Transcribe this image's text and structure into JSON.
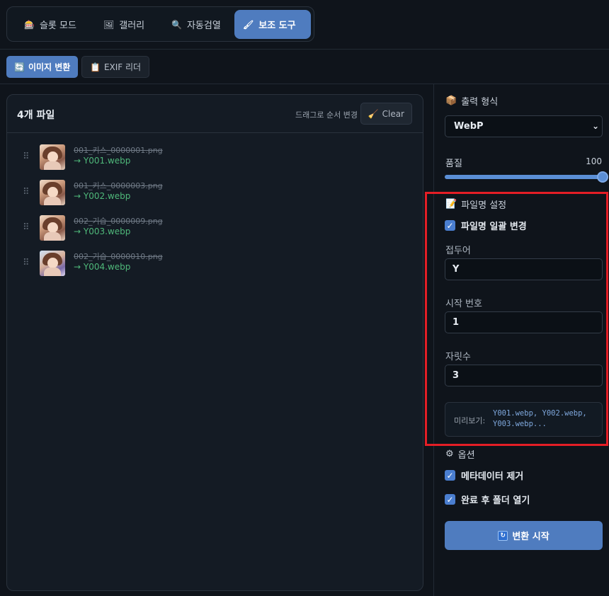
{
  "tabs": [
    {
      "icon": "slot-icon",
      "glyph": "🎰",
      "label": "슬롯 모드",
      "active": false
    },
    {
      "icon": "gallery-icon",
      "glyph": "🖼",
      "label": "갤러리",
      "active": false
    },
    {
      "icon": "search-icon",
      "glyph": "🔍",
      "label": "자동검열",
      "active": false
    },
    {
      "icon": "brush-icon",
      "glyph": "🖌",
      "label": "보조 도구",
      "active": true
    }
  ],
  "subtabs": [
    {
      "icon": "convert-icon",
      "glyph": "🔄",
      "label": "이미지 변환",
      "active": true
    },
    {
      "icon": "clipboard-icon",
      "glyph": "📋",
      "label": "EXIF 리더",
      "active": false
    }
  ],
  "file_panel": {
    "title": "4개 파일",
    "hint": "드래그로 순서 변경",
    "clear_label": "Clear",
    "files": [
      {
        "original": "001_키스_0000001.png",
        "renamed": "→ Y001.webp"
      },
      {
        "original": "001_키스_0000003.png",
        "renamed": "→ Y002.webp"
      },
      {
        "original": "002_기습_0000009.png",
        "renamed": "→ Y003.webp"
      },
      {
        "original": "002_기습_0000010.png",
        "renamed": "→ Y004.webp"
      }
    ]
  },
  "output": {
    "title": "출력 형식",
    "format": "WebP",
    "quality_label": "품질",
    "quality_value": "100",
    "quality_fraction": 1.0
  },
  "filename": {
    "title": "파일명 설정",
    "batch_rename_label": "파일명 일괄 변경",
    "batch_rename_checked": true,
    "prefix_label": "접두어",
    "prefix_value": "Y",
    "start_label": "시작 번호",
    "start_value": "1",
    "digits_label": "자릿수",
    "digits_value": "3",
    "preview_label": "미리보기:",
    "preview_value": "Y001.webp, Y002.webp, Y003.webp..."
  },
  "options": {
    "title": "옵션",
    "remove_metadata_label": "메타데이터 제거",
    "remove_metadata_checked": true,
    "open_folder_label": "완료 후 폴더 열기",
    "open_folder_checked": true
  },
  "start_label": "변환 시작",
  "colors": {
    "accent": "#4f7cbf",
    "highlight": "#e41e26",
    "renamed_text": "#4fb87a"
  }
}
